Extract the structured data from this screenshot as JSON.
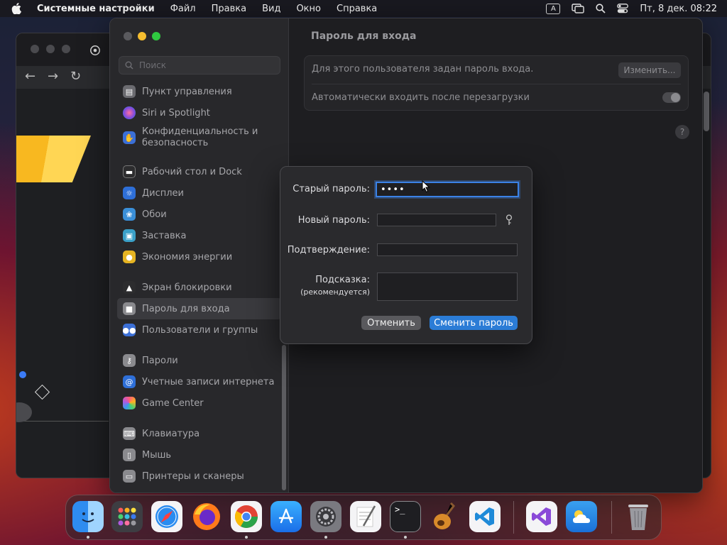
{
  "menubar": {
    "app_name": "Системные настройки",
    "items": [
      "Файл",
      "Правка",
      "Вид",
      "Окно",
      "Справка"
    ],
    "input_indicator": "A",
    "datetime": "Пт, 8 дек.  08:22"
  },
  "sidebar": {
    "search_placeholder": "Поиск",
    "items": [
      {
        "label": "Пункт управления",
        "icon": "control-center-icon",
        "color": "#6b6b70"
      },
      {
        "label": "Siri и Spotlight",
        "icon": "siri-icon",
        "color": "#b04ad6"
      },
      {
        "label": "Конфиденциальность и безопасность",
        "icon": "hand-icon",
        "color": "#3b6fd6"
      },
      {
        "label": "Рабочий стол и Dock",
        "icon": "desktop-dock-icon",
        "color": "#2c2c2e"
      },
      {
        "label": "Дисплеи",
        "icon": "sun-icon",
        "color": "#2e6fd8"
      },
      {
        "label": "Обои",
        "icon": "flower-icon",
        "color": "#3a8fd8"
      },
      {
        "label": "Заставка",
        "icon": "screensaver-icon",
        "color": "#3aa0c8"
      },
      {
        "label": "Экономия энергии",
        "icon": "bulb-icon",
        "color": "#e6b422"
      },
      {
        "label": "Экран блокировки",
        "icon": "lock-screen-icon",
        "color": "#2c2c2e"
      },
      {
        "label": "Пароль для входа",
        "icon": "lock-icon",
        "color": "#8a8a8e"
      },
      {
        "label": "Пользователи и группы",
        "icon": "users-icon",
        "color": "#3b6fd6"
      },
      {
        "label": "Пароли",
        "icon": "key-icon",
        "color": "#8a8a8e"
      },
      {
        "label": "Учетные записи интернета",
        "icon": "at-icon",
        "color": "#2e6fd8"
      },
      {
        "label": "Game Center",
        "icon": "game-center-icon",
        "color": "#d84a6a"
      },
      {
        "label": "Клавиатура",
        "icon": "keyboard-icon",
        "color": "#8a8a8e"
      },
      {
        "label": "Мышь",
        "icon": "mouse-icon",
        "color": "#8a8a8e"
      },
      {
        "label": "Принтеры и сканеры",
        "icon": "printer-icon",
        "color": "#8a8a8e"
      }
    ]
  },
  "main": {
    "title": "Пароль для входа",
    "row1_text": "Для этого пользователя задан пароль входа.",
    "change_button": "Изменить...",
    "row2_text": "Автоматически входить после перезагрузки",
    "help_symbol": "?"
  },
  "sheet": {
    "old_password_label": "Старый пароль:",
    "old_password_value": "••••",
    "new_password_label": "Новый пароль:",
    "confirm_label": "Подтверждение:",
    "hint_label": "Подсказка:",
    "hint_sublabel": "(рекомендуется)",
    "cancel_button": "Отменить",
    "change_password_button": "Сменить пароль"
  },
  "colors": {
    "accent": "#2b7cd6",
    "focus_ring": "#3b82e6"
  },
  "dock": {
    "apps": [
      "finder-icon",
      "launchpad-icon",
      "safari-icon",
      "firefox-icon",
      "chrome-icon",
      "app-store-icon",
      "system-settings-icon",
      "textedit-icon",
      "terminal-icon",
      "garageband-icon",
      "vscode-icon",
      "visual-studio-icon",
      "weather-icon",
      "trash-icon"
    ],
    "terminal_prompt": ">_"
  }
}
